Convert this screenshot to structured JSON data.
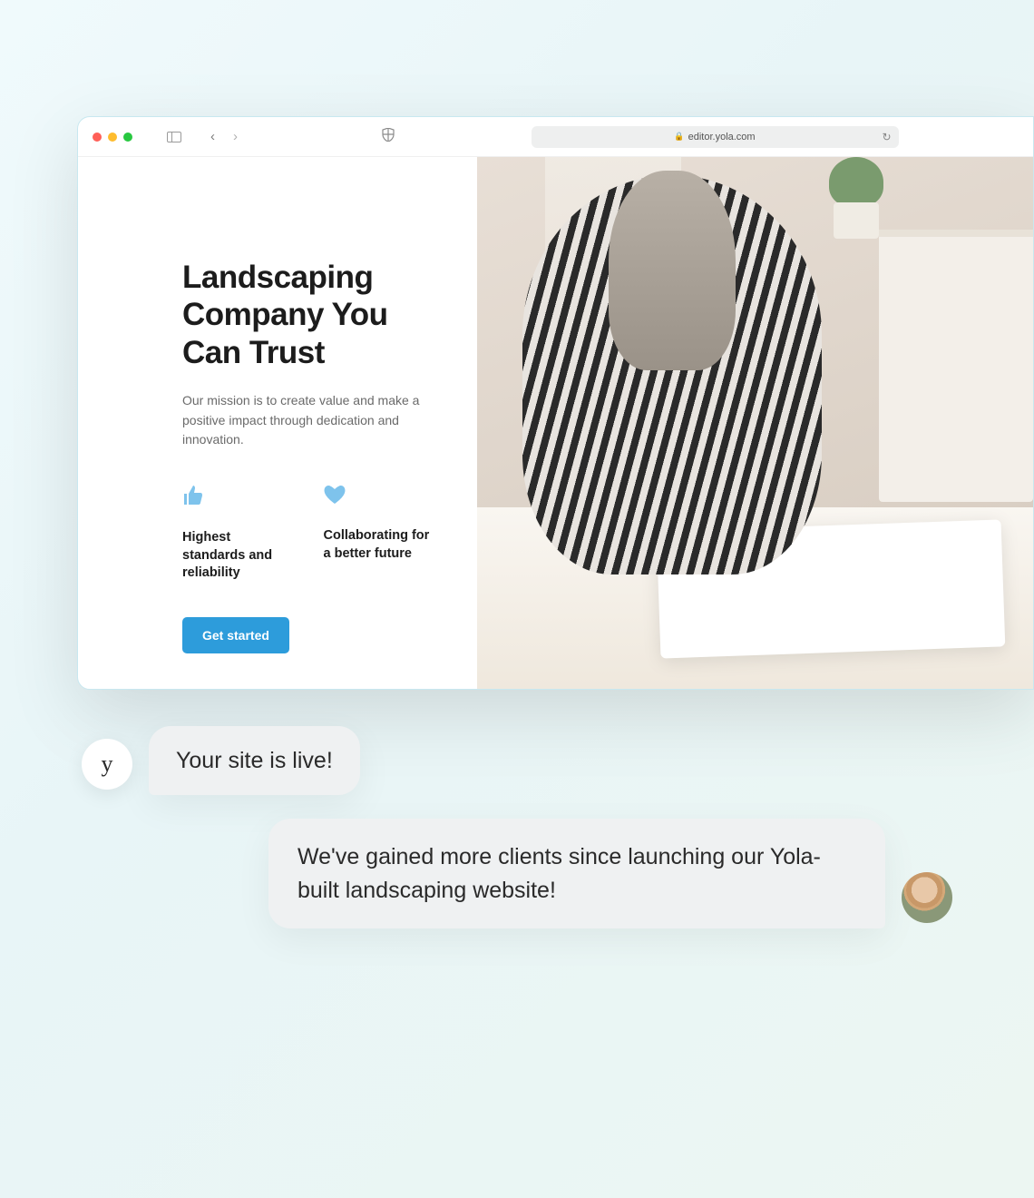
{
  "browser": {
    "url": "editor.yola.com"
  },
  "hero": {
    "title": "Landscaping Company You Can Trust",
    "description": "Our mission is to create value and make a positive impact through dedication and innovation.",
    "cta": "Get started"
  },
  "features": {
    "f1": "Highest standards and reliability",
    "f2": "Collaborating for a better future"
  },
  "chat": {
    "msg1": "Your site is live!",
    "msg2": "We've gained more clients since launching our Yola-built landscaping website!"
  },
  "brand": {
    "letter": "y"
  }
}
